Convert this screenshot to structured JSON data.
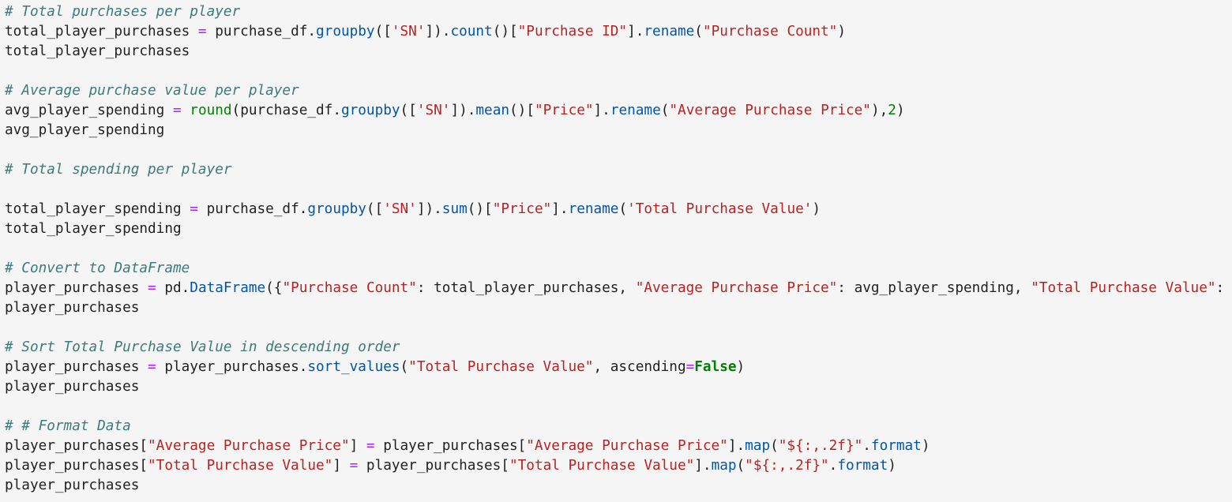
{
  "cell": {
    "language": "python",
    "lines": [
      [
        {
          "t": "# Total purchases per player",
          "k": "c"
        }
      ],
      [
        {
          "t": "total_player_purchases ",
          "k": "p"
        },
        {
          "t": "=",
          "k": "o"
        },
        {
          "t": " purchase_df.",
          "k": "p"
        },
        {
          "t": "groupby",
          "k": "f"
        },
        {
          "t": "([",
          "k": "p"
        },
        {
          "t": "'SN'",
          "k": "s"
        },
        {
          "t": "]).",
          "k": "p"
        },
        {
          "t": "count",
          "k": "f"
        },
        {
          "t": "()[",
          "k": "p"
        },
        {
          "t": "\"Purchase ID\"",
          "k": "s"
        },
        {
          "t": "].",
          "k": "p"
        },
        {
          "t": "rename",
          "k": "f"
        },
        {
          "t": "(",
          "k": "p"
        },
        {
          "t": "\"Purchase Count\"",
          "k": "s"
        },
        {
          "t": ")",
          "k": "p"
        }
      ],
      [
        {
          "t": "total_player_purchases",
          "k": "p"
        }
      ],
      [],
      [
        {
          "t": "# Average purchase value per player",
          "k": "c"
        }
      ],
      [
        {
          "t": "avg_player_spending ",
          "k": "p"
        },
        {
          "t": "=",
          "k": "o"
        },
        {
          "t": " ",
          "k": "p"
        },
        {
          "t": "round",
          "k": "b"
        },
        {
          "t": "(purchase_df.",
          "k": "p"
        },
        {
          "t": "groupby",
          "k": "f"
        },
        {
          "t": "([",
          "k": "p"
        },
        {
          "t": "'SN'",
          "k": "s"
        },
        {
          "t": "]).",
          "k": "p"
        },
        {
          "t": "mean",
          "k": "f"
        },
        {
          "t": "()[",
          "k": "p"
        },
        {
          "t": "\"Price\"",
          "k": "s"
        },
        {
          "t": "].",
          "k": "p"
        },
        {
          "t": "rename",
          "k": "f"
        },
        {
          "t": "(",
          "k": "p"
        },
        {
          "t": "\"Average Purchase Price\"",
          "k": "s"
        },
        {
          "t": "),",
          "k": "p"
        },
        {
          "t": "2",
          "k": "n"
        },
        {
          "t": ")",
          "k": "p"
        }
      ],
      [
        {
          "t": "avg_player_spending",
          "k": "p"
        }
      ],
      [],
      [
        {
          "t": "# Total spending per player",
          "k": "c"
        }
      ],
      [],
      [
        {
          "t": "total_player_spending ",
          "k": "p"
        },
        {
          "t": "=",
          "k": "o"
        },
        {
          "t": " purchase_df.",
          "k": "p"
        },
        {
          "t": "groupby",
          "k": "f"
        },
        {
          "t": "([",
          "k": "p"
        },
        {
          "t": "'SN'",
          "k": "s"
        },
        {
          "t": "]).",
          "k": "p"
        },
        {
          "t": "sum",
          "k": "f"
        },
        {
          "t": "()[",
          "k": "p"
        },
        {
          "t": "\"Price\"",
          "k": "s"
        },
        {
          "t": "].",
          "k": "p"
        },
        {
          "t": "rename",
          "k": "f"
        },
        {
          "t": "(",
          "k": "p"
        },
        {
          "t": "'Total Purchase Value'",
          "k": "s"
        },
        {
          "t": ")",
          "k": "p"
        }
      ],
      [
        {
          "t": "total_player_spending",
          "k": "p"
        }
      ],
      [],
      [
        {
          "t": "# Convert to DataFrame",
          "k": "c"
        }
      ],
      [
        {
          "t": "player_purchases ",
          "k": "p"
        },
        {
          "t": "=",
          "k": "o"
        },
        {
          "t": " pd.",
          "k": "p"
        },
        {
          "t": "DataFrame",
          "k": "f"
        },
        {
          "t": "({",
          "k": "p"
        },
        {
          "t": "\"Purchase Count\"",
          "k": "s"
        },
        {
          "t": ": total_player_purchases, ",
          "k": "p"
        },
        {
          "t": "\"Average Purchase Price\"",
          "k": "s"
        },
        {
          "t": ": avg_player_spending, ",
          "k": "p"
        },
        {
          "t": "\"Total Purchase Value\"",
          "k": "s"
        },
        {
          "t": ":",
          "k": "p"
        }
      ],
      [
        {
          "t": "player_purchases",
          "k": "p"
        }
      ],
      [],
      [
        {
          "t": "# Sort Total Purchase Value in descending order",
          "k": "c"
        }
      ],
      [
        {
          "t": "player_purchases ",
          "k": "p"
        },
        {
          "t": "=",
          "k": "o"
        },
        {
          "t": " player_purchases.",
          "k": "p"
        },
        {
          "t": "sort_values",
          "k": "f"
        },
        {
          "t": "(",
          "k": "p"
        },
        {
          "t": "\"Total Purchase Value\"",
          "k": "s"
        },
        {
          "t": ", ascending",
          "k": "p"
        },
        {
          "t": "=",
          "k": "o"
        },
        {
          "t": "False",
          "k": "k"
        },
        {
          "t": ")",
          "k": "p"
        }
      ],
      [
        {
          "t": "player_purchases",
          "k": "p"
        }
      ],
      [],
      [
        {
          "t": "# # Format Data",
          "k": "c"
        }
      ],
      [
        {
          "t": "player_purchases[",
          "k": "p"
        },
        {
          "t": "\"Average Purchase Price\"",
          "k": "s"
        },
        {
          "t": "] ",
          "k": "p"
        },
        {
          "t": "=",
          "k": "o"
        },
        {
          "t": " player_purchases[",
          "k": "p"
        },
        {
          "t": "\"Average Purchase Price\"",
          "k": "s"
        },
        {
          "t": "].",
          "k": "p"
        },
        {
          "t": "map",
          "k": "f"
        },
        {
          "t": "(",
          "k": "p"
        },
        {
          "t": "\"${:,.2f}\"",
          "k": "s"
        },
        {
          "t": ".",
          "k": "p"
        },
        {
          "t": "format",
          "k": "f"
        },
        {
          "t": ")",
          "k": "p"
        }
      ],
      [
        {
          "t": "player_purchases[",
          "k": "p"
        },
        {
          "t": "\"Total Purchase Value\"",
          "k": "s"
        },
        {
          "t": "] ",
          "k": "p"
        },
        {
          "t": "=",
          "k": "o"
        },
        {
          "t": " player_purchases[",
          "k": "p"
        },
        {
          "t": "\"Total Purchase Value\"",
          "k": "s"
        },
        {
          "t": "].",
          "k": "p"
        },
        {
          "t": "map",
          "k": "f"
        },
        {
          "t": "(",
          "k": "p"
        },
        {
          "t": "\"${:,.2f}\"",
          "k": "s"
        },
        {
          "t": ".",
          "k": "p"
        },
        {
          "t": "format",
          "k": "f"
        },
        {
          "t": ")",
          "k": "p"
        }
      ],
      [
        {
          "t": "player_purchases",
          "k": "p"
        }
      ]
    ]
  },
  "colors": {
    "background": "#f5f5f5",
    "text": "#212121",
    "comment": "#3d7a7a",
    "string": "#ba2121",
    "function": "#0055aa",
    "keyword": "#008000",
    "builtin": "#008000",
    "number": "#008000",
    "operator": "#aa22ff"
  }
}
